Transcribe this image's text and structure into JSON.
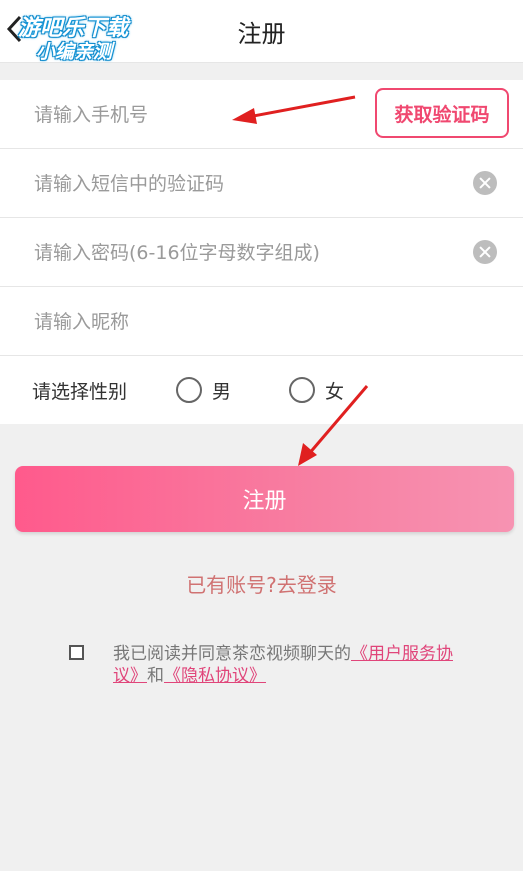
{
  "header": {
    "title": "注册",
    "watermark_line1": "游吧乐下载",
    "watermark_line2": "小编亲测"
  },
  "form": {
    "phone_placeholder": "请输入手机号",
    "get_code_label": "获取验证码",
    "sms_code_placeholder": "请输入短信中的验证码",
    "password_placeholder": "请输入密码(6-16位字母数字组成)",
    "nickname_placeholder": "请输入昵称",
    "gender_label": "请选择性别",
    "gender_options": [
      "男",
      "女"
    ]
  },
  "submit_label": "注册",
  "login_link": "已有账号?去登录",
  "agreement": {
    "text": "我已阅读并同意茶恋视频聊天的",
    "user_agreement": "《用户服务协议》",
    "and": "和",
    "privacy": "《隐私协议》"
  },
  "colors": {
    "accent": "#f04870",
    "button_gradient_start": "#ff5a8c",
    "button_gradient_end": "#f793b2",
    "annotation_arrow": "#e02020"
  }
}
